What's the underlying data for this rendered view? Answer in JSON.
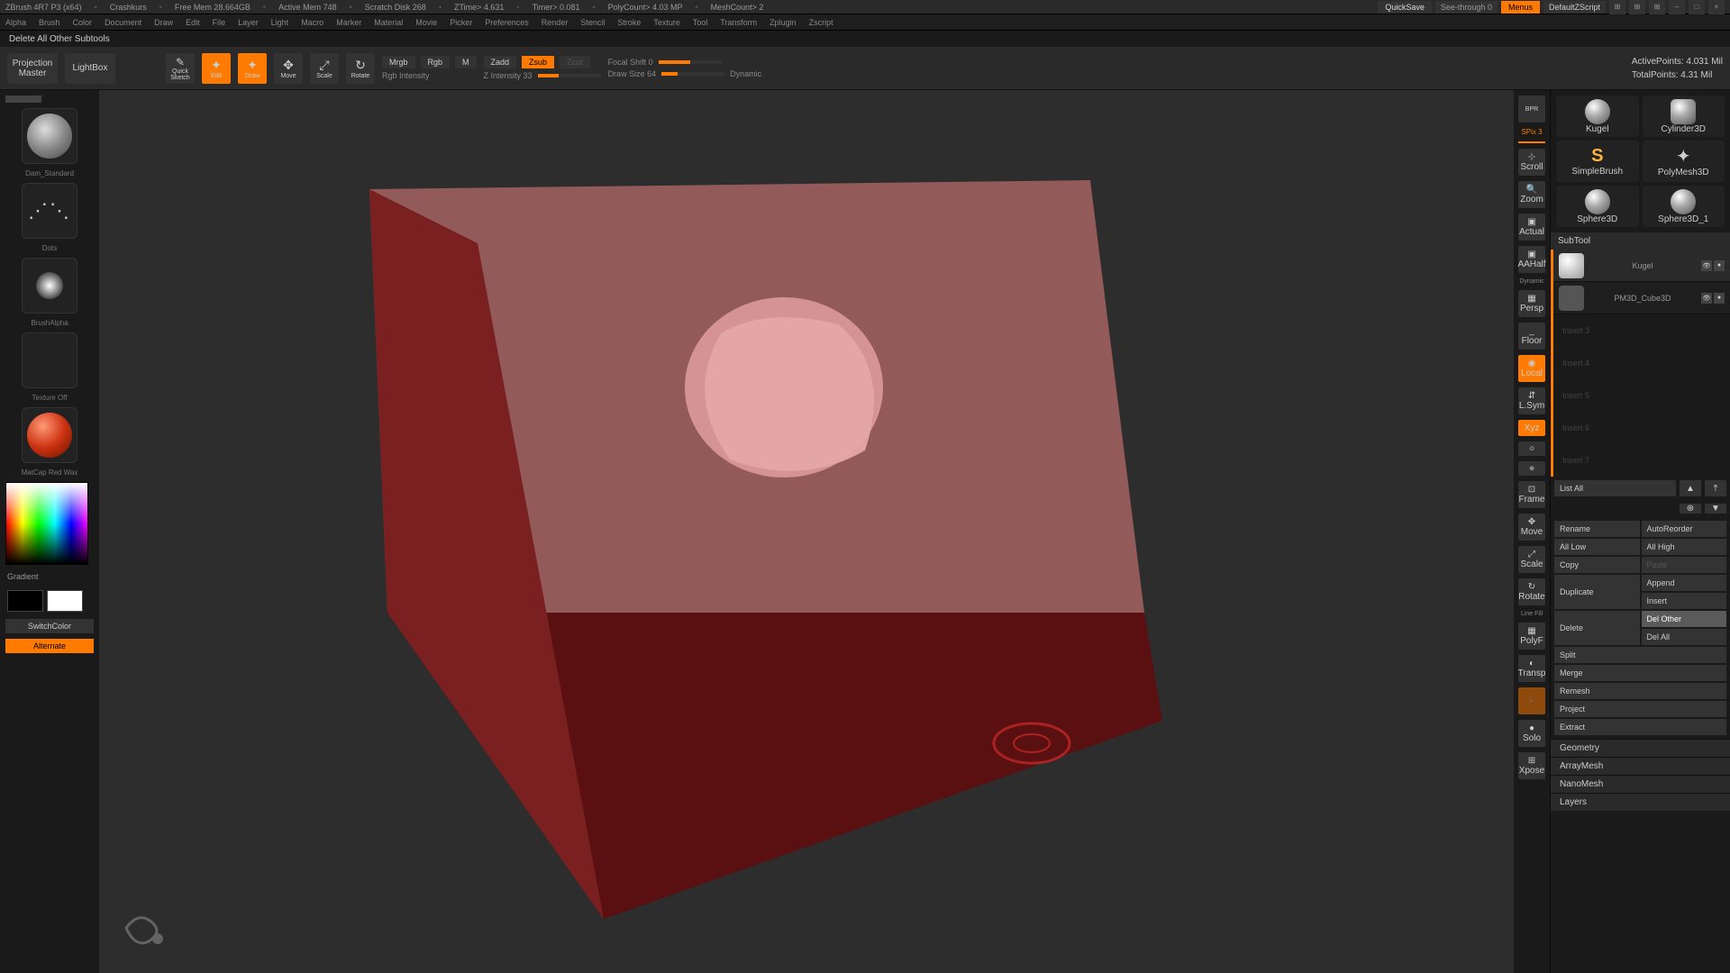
{
  "title": {
    "app": "ZBrush 4R7 P3 (x64)",
    "doc": "Crashkurs",
    "mem": "Free Mem 28.664GB",
    "amem": "Active Mem 748",
    "scratch": "Scratch Disk 268",
    "ztime": "ZTime> 4.631",
    "timer": "Timer> 0.081",
    "poly": "PolyCount> 4.03 MP",
    "mesh": "MeshCount> 2",
    "quicksave": "QuickSave",
    "seethrough": "See-through   0",
    "menus": "Menus",
    "script": "DefaultZScript"
  },
  "menus": [
    "Alpha",
    "Brush",
    "Color",
    "Document",
    "Draw",
    "Edit",
    "File",
    "Layer",
    "Light",
    "Macro",
    "Marker",
    "Material",
    "Movie",
    "Picker",
    "Preferences",
    "Render",
    "Stencil",
    "Stroke",
    "Texture",
    "Tool",
    "Transform",
    "Zplugin",
    "Zscript"
  ],
  "status": "Delete All Other Subtools",
  "toolbar": {
    "proj": "Projection Master",
    "lightbox": "LightBox",
    "quicksketch": "Quick Sketch",
    "edit": "Edit",
    "draw": "Draw",
    "move": "Move",
    "scale": "Scale",
    "rotate": "Rotate",
    "mrgb": "Mrgb",
    "rgb": "Rgb",
    "m": "M",
    "rgbint": "Rgb Intensity",
    "zadd": "Zadd",
    "zsub": "Zsub",
    "zcut": "Zcut",
    "zint": "Z Intensity 33",
    "focal": "Focal Shift 0",
    "drawsize": "Draw Size 64",
    "dynamic": "Dynamic",
    "active": "ActivePoints: 4.031 Mil",
    "total": "TotalPoints: 4.31 Mil"
  },
  "left": {
    "brush": "Dam_Standard",
    "stroke": "Dots",
    "alpha": "BrushAlpha",
    "tex": "Texture Off",
    "mat": "MatCap Red Wax",
    "gradient": "Gradient",
    "switch": "SwitchColor",
    "alternate": "Alternate"
  },
  "rstrip": {
    "spix": "SPix 3",
    "scroll": "Scroll",
    "zoom": "Zoom",
    "actual": "Actual",
    "aahalf": "AAHalf",
    "persp": "Persp",
    "floor": "Floor",
    "local": "Local",
    "lsym": "L.Sym",
    "xyz": "Xyz",
    "frame": "Frame",
    "movesc": "Move",
    "scale": "Scale",
    "rotate": "Rotate",
    "linefill": "Line Fill",
    "polyf": "PolyF",
    "transp": "Transp",
    "solo": "Solo",
    "xpose": "Xpose"
  },
  "tools": {
    "kugel": "Kugel",
    "cyl": "Cylinder3D",
    "sb": "SimpleBrush",
    "s3d": "Sphere3D",
    "s3d1": "Sphere3D_1",
    "kugel2": "Kugel"
  },
  "subtool": {
    "header": "SubTool",
    "items": [
      {
        "name": "Kugel"
      },
      {
        "name": "PM3D_Cube3D"
      }
    ],
    "empty": [
      "Insert 3",
      "Insert 4",
      "Insert 5",
      "Insert 6",
      "Insert 7"
    ],
    "listall": "List All",
    "rename": "Rename",
    "autoreorder": "AutoReorder",
    "alllow": "All Low",
    "allhigh": "All High",
    "copy": "Copy",
    "paste": "Paste",
    "duplicate": "Duplicate",
    "append": "Append",
    "insert": "Insert",
    "delete": "Delete",
    "delother": "Del Other",
    "delall": "Del All",
    "split": "Split",
    "merge": "Merge",
    "remesh": "Remesh",
    "project": "Project",
    "extract": "Extract"
  },
  "sections": [
    "Geometry",
    "ArrayMesh",
    "NanoMesh",
    "Layers"
  ]
}
